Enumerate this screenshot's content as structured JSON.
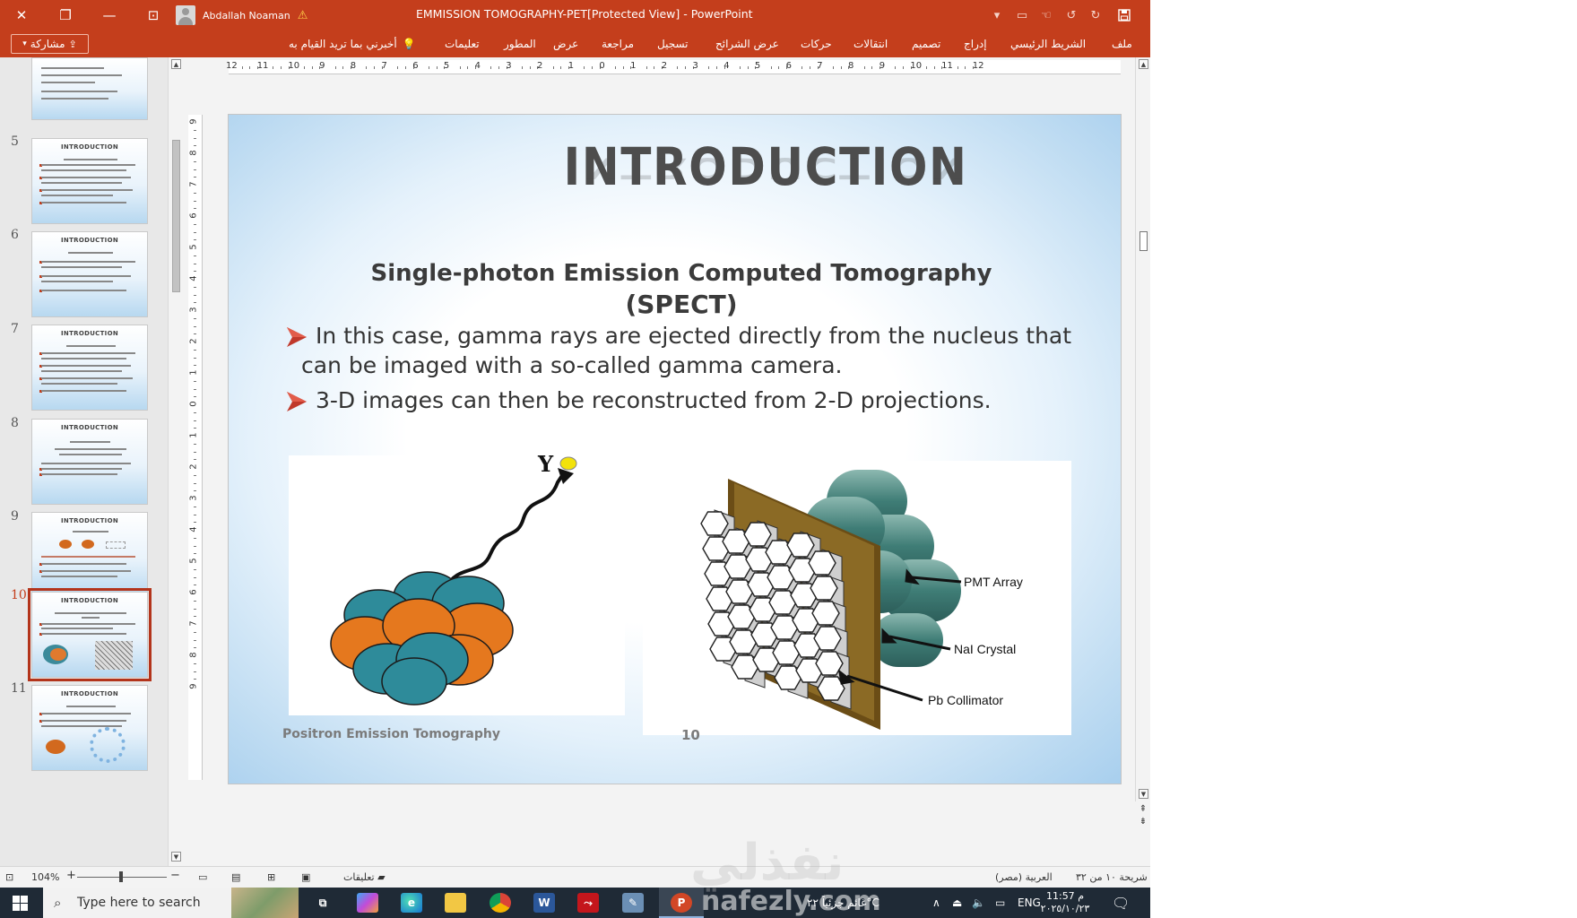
{
  "window": {
    "title": "EMMISSION TOMOGRAPHY-PET[Protected View]  -  PowerPoint",
    "user": "Abdallah Noaman",
    "share_label": "مشاركة"
  },
  "ribbon": {
    "tabs": [
      "ملف",
      "الشريط الرئيسي",
      "إدراج",
      "تصميم",
      "انتقالات",
      "حركات",
      "عرض الشرائح",
      "تسجيل",
      "مراجعة",
      "عرض",
      "المطور",
      "تعليمات"
    ],
    "tell_me": "أخبرني بما تريد القيام به"
  },
  "thumbnails": [
    {
      "number": "",
      "title": "",
      "selected": false
    },
    {
      "number": "5",
      "title": "INTRODUCTION",
      "selected": false
    },
    {
      "number": "6",
      "title": "INTRODUCTION",
      "selected": false
    },
    {
      "number": "7",
      "title": "INTRODUCTION",
      "selected": false
    },
    {
      "number": "8",
      "title": "INTRODUCTION",
      "selected": false
    },
    {
      "number": "9",
      "title": "INTRODUCTION",
      "selected": false
    },
    {
      "number": "10",
      "title": "INTRODUCTION",
      "selected": true
    },
    {
      "number": "11",
      "title": "INTRODUCTION",
      "selected": false
    }
  ],
  "ruler": {
    "horizontal": [
      "12",
      "11",
      "10",
      "9",
      "8",
      "7",
      "6",
      "5",
      "4",
      "3",
      "2",
      "1",
      "0",
      "1",
      "2",
      "3",
      "4",
      "5",
      "6",
      "7",
      "8",
      "9",
      "10",
      "11",
      "12"
    ],
    "vertical": [
      "9",
      "8",
      "7",
      "6",
      "5",
      "4",
      "3",
      "2",
      "1",
      "0",
      "1",
      "2",
      "3",
      "4",
      "5",
      "6",
      "7",
      "8",
      "9"
    ]
  },
  "slide": {
    "title": "INTRODUCTION",
    "subtitle_line1": "Single-photon Emission Computed Tomography",
    "subtitle_line2": "(SPECT)",
    "bullets": [
      {
        "line1": "In this case, gamma rays are ejected directly from the nucleus that",
        "line2": "can be imaged with a so-called gamma camera."
      },
      {
        "line1": "3-D images can then be reconstructed from 2-D projections.",
        "line2": ""
      }
    ],
    "gamma_symbol": "Y",
    "labels": {
      "pmt": "PMT Array",
      "nai": "NaI Crystal",
      "pb": "Pb Collimator"
    },
    "footer": "Positron Emission Tomography",
    "page_number": "10",
    "accent_color": "#c43e1c",
    "bullet_color": "#c0392b"
  },
  "statusbar": {
    "zoom": "104%",
    "comments": "تعليقات",
    "language": "العربية (مصر)",
    "slide_info": "شريحة ١٠ من ٣٢"
  },
  "taskbar": {
    "search_placeholder": "Type here to search",
    "weather": "غائم جزئياً ٢٢°C",
    "language": "ENG",
    "time": "11:57 م",
    "date": "٢٠٢٥/١٠/٢٣"
  },
  "watermark": {
    "arabic": "نفذلي",
    "latin": "nafezly.com"
  }
}
